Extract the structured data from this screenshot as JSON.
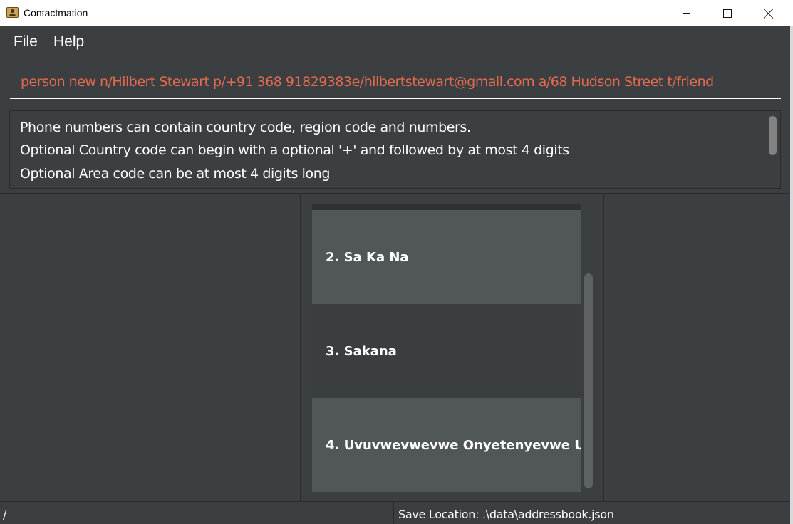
{
  "window": {
    "title": "Contactmation"
  },
  "menu": {
    "file_label": "File",
    "help_label": "Help"
  },
  "command": {
    "value": "person new n/Hilbert Stewart p/+91 368 91829383e/hilbertstewart@gmail.com a/68 Hudson Street t/friend",
    "text_color": "#e26a4e"
  },
  "result": {
    "lines": [
      "Phone numbers can contain country code, region code and numbers.",
      "Optional Country code can begin with a optional '+' and followed by at most 4 digits",
      "Optional Area code can be at most 4 digits long"
    ]
  },
  "person_list": {
    "items": [
      {
        "label": "2.  Sa Ka Na"
      },
      {
        "label": "3.  Sakana"
      },
      {
        "label": "4.  Uvuvwevwevwe Onyetenyevwe U..."
      }
    ]
  },
  "statusbar": {
    "left_text": "/",
    "save_location": "Save Location: .\\data\\addressbook.json"
  },
  "icons": {
    "app": "contact-book-icon",
    "minimize": "minimize-icon",
    "maximize": "maximize-icon",
    "close": "close-icon"
  },
  "colors": {
    "background": "#3c3f41",
    "list_item_highlight": "#515658",
    "list_item_dark": "#3b3e40"
  }
}
